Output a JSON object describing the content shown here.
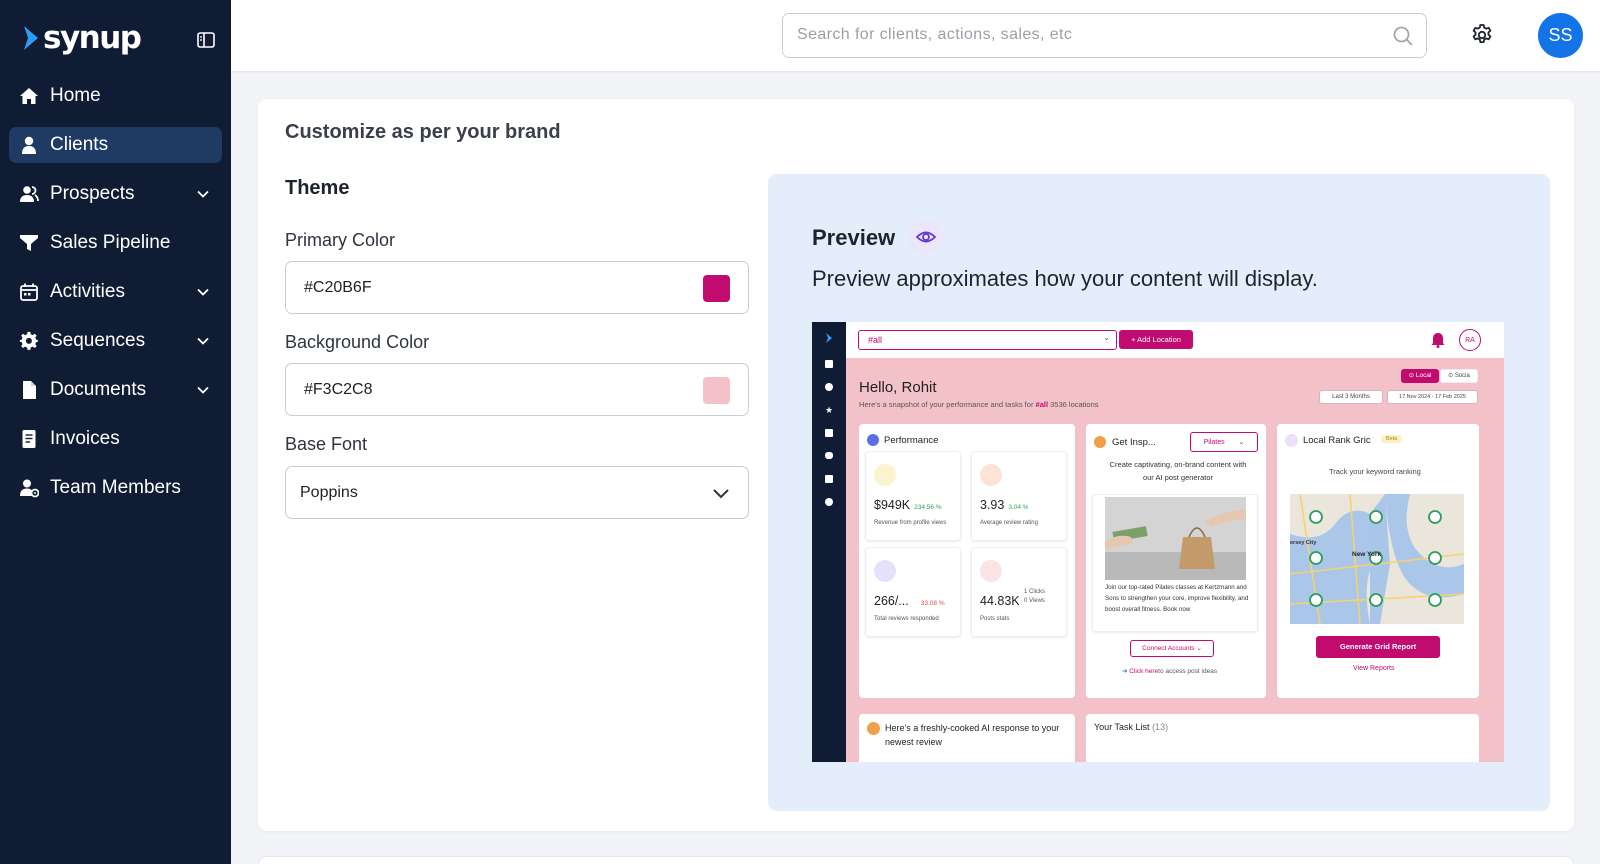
{
  "app": {
    "name": "synup"
  },
  "nav": [
    {
      "label": "Home",
      "icon": "home-icon",
      "active": false,
      "has_children": false
    },
    {
      "label": "Clients",
      "icon": "user-icon",
      "active": true,
      "has_children": false
    },
    {
      "label": "Prospects",
      "icon": "users-icon",
      "active": false,
      "has_children": true
    },
    {
      "label": "Sales Pipeline",
      "icon": "funnel-icon",
      "active": false,
      "has_children": false
    },
    {
      "label": "Activities",
      "icon": "calendar-icon",
      "active": false,
      "has_children": true
    },
    {
      "label": "Sequences",
      "icon": "gear-icon",
      "active": false,
      "has_children": true
    },
    {
      "label": "Documents",
      "icon": "document-icon",
      "active": false,
      "has_children": true
    },
    {
      "label": "Invoices",
      "icon": "invoice-icon",
      "active": false,
      "has_children": false
    },
    {
      "label": "Team Members",
      "icon": "team-icon",
      "active": false,
      "has_children": false
    }
  ],
  "topbar": {
    "search_placeholder": "Search for clients, actions, sales, etc",
    "avatar_initials": "SS"
  },
  "brand": {
    "title": "Customize as per your brand",
    "theme_title": "Theme",
    "primary_label": "Primary Color",
    "primary_value": "#C20B6F",
    "background_label": "Background Color",
    "background_value": "#F3C2C8",
    "font_label": "Base Font",
    "font_value": "Poppins"
  },
  "preview": {
    "title": "Preview",
    "description": "Preview approximates how your content will display.",
    "mock": {
      "select_value": "#all",
      "add_location": "+ Add Location",
      "avatar": "RA",
      "greeting": "Hello, Rohit",
      "subtitle_pre": "Here's a snapshot of your performance and tasks for",
      "subtitle_tag": "#all",
      "subtitle_post": "3536 locations",
      "tab_local": "Local",
      "tab_social": "Socia",
      "range": "Last 3 Months",
      "dates": "17 Nov 2024 - 17 Feb 2025",
      "performance_title": "Performance",
      "stats": [
        {
          "value": "$949K",
          "pct": "234.56 %",
          "label": "Revenue from profile views",
          "pct_color": "#2e9d5b"
        },
        {
          "value": "3.93",
          "pct": "3.04 %",
          "label": "Average review rating",
          "pct_color": "#2e9d5b"
        },
        {
          "value": "266/...",
          "pct": "33.08 %",
          "label": "Total reviews responded",
          "pct_color": "#e04848"
        },
        {
          "value": "44.83K",
          "pct": "",
          "label": "Posts stats",
          "pct_color": "#555"
        }
      ],
      "clicks_label": "1 Clicks",
      "views_label": "0 Views",
      "insp_title": "Get Insp...",
      "insp_select": "Pilates",
      "insp_text": "Create captivating, on-brand content with our AI post generator",
      "insp_post": "Join our top-rated Pilates classes at Kertzmann and Sons to strengthen your core, improve flexibility, and boost overall fitness. Book now",
      "connect_accounts": "Connect Accounts",
      "click_here": "Click here",
      "click_here_rest": "to access post ideas",
      "rank_title": "Local Rank Gric",
      "beta": "Beta",
      "rank_sub": "Track your keyword ranking",
      "map_label_1": "ersey City",
      "map_label_2": "New York",
      "generate_report": "Generate Grid Report",
      "view_reports": "View Reports",
      "ai_text": "Here's a freshly-cooked AI response to your newest review",
      "task_title": "Your Task List",
      "task_count": "(13)"
    }
  },
  "colors": {
    "sidebar": "#0f1c33",
    "active_nav": "#1f3a63",
    "primary": "#C20B6F",
    "background": "#F3C2C8",
    "avatar": "#1473e6"
  }
}
